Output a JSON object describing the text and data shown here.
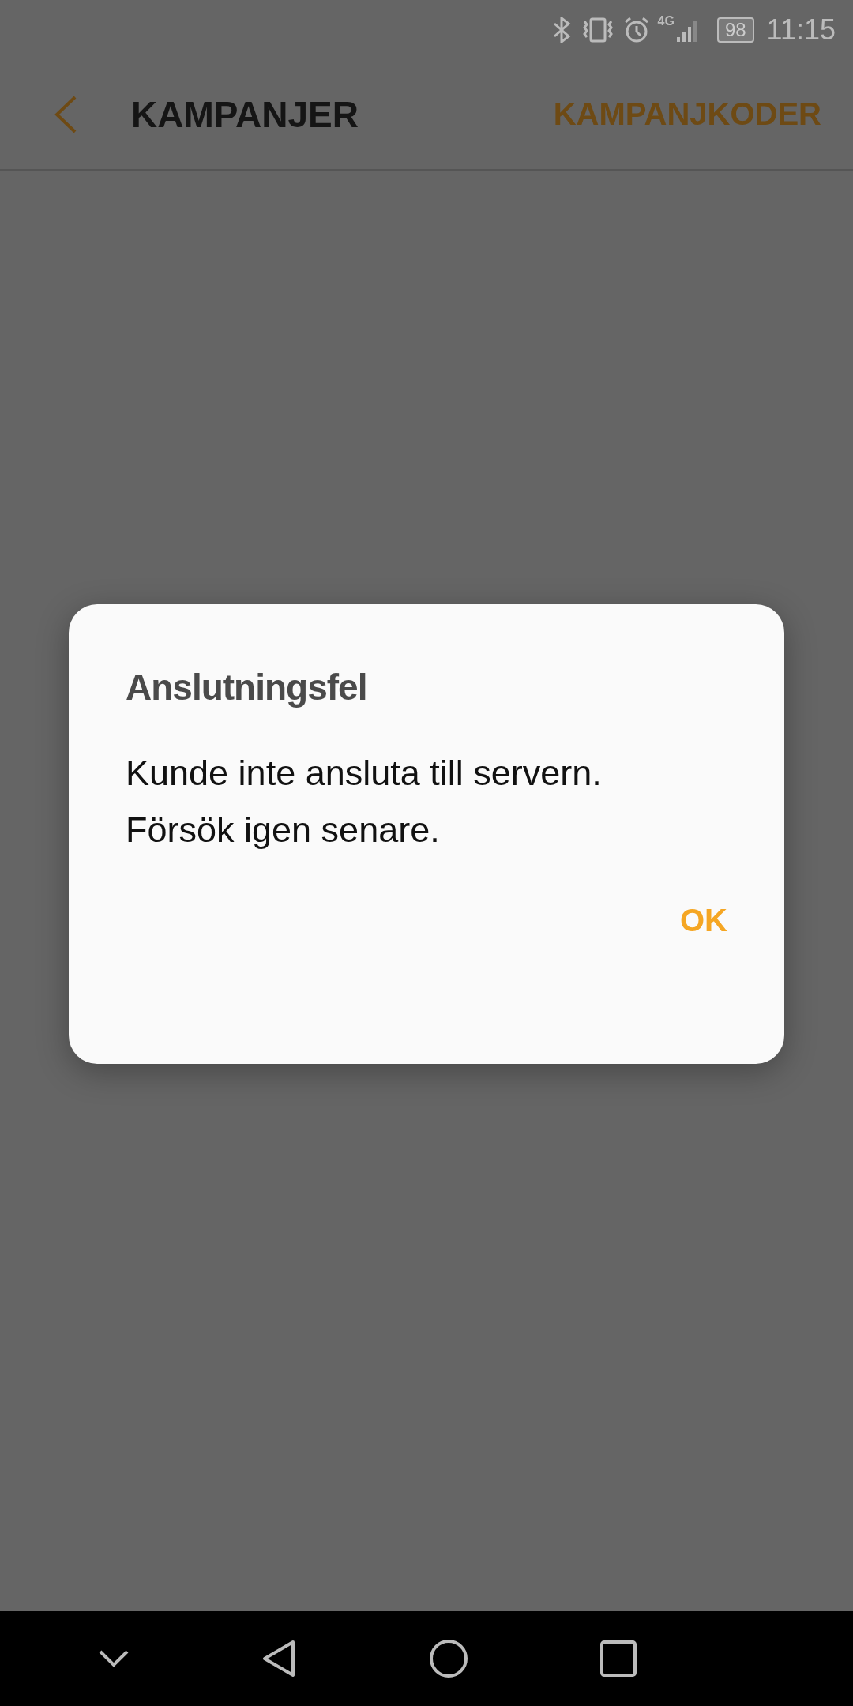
{
  "status_bar": {
    "network": "4G",
    "battery": "98",
    "time": "11:15"
  },
  "header": {
    "title": "KAMPANJER",
    "action": "KAMPANJKODER"
  },
  "dialog": {
    "title": "Anslutningsfel",
    "message": [
      "Kunde inte ansluta till servern.",
      "Försök igen senare."
    ],
    "button": "OK"
  }
}
